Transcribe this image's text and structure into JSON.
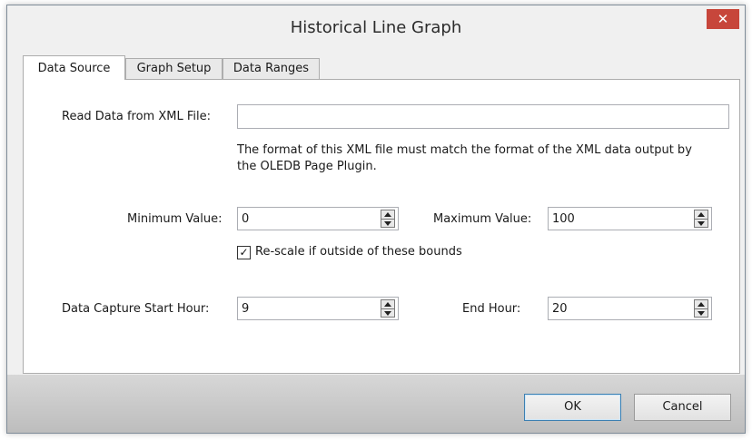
{
  "window": {
    "title": "Historical Line Graph",
    "close_glyph": "✕"
  },
  "tabs": [
    {
      "label": "Data Source",
      "active": true
    },
    {
      "label": "Graph Setup",
      "active": false
    },
    {
      "label": "Data Ranges",
      "active": false
    }
  ],
  "data_source": {
    "xml_file_label": "Read Data from XML File:",
    "xml_file_value": "",
    "hint_line1": "The format of this XML file must match the format of the XML data output by",
    "hint_line2": "the OLEDB Page Plugin.",
    "min_label": "Minimum Value:",
    "min_value": "0",
    "max_label": "Maximum Value:",
    "max_value": "100",
    "rescale_label": "Re-scale if outside of these bounds",
    "rescale_checked": true,
    "rescale_glyph": "✓",
    "start_hour_label": "Data Capture Start Hour:",
    "start_hour_value": "9",
    "end_hour_label": "End Hour:",
    "end_hour_value": "20"
  },
  "buttons": {
    "ok": "OK",
    "cancel": "Cancel"
  },
  "colors": {
    "close_button": "#c7463b",
    "default_button_border": "#3c7fb1"
  }
}
